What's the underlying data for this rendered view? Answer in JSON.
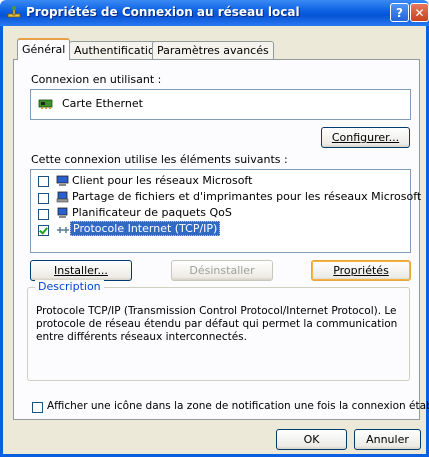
{
  "window": {
    "title": "Propriétés de Connexion au réseau local",
    "help_label": "?",
    "close_label": "✕"
  },
  "tabs": [
    {
      "label": "Général",
      "active": true
    },
    {
      "label": "Authentification",
      "active": false
    },
    {
      "label": "Paramètres avancés",
      "active": false
    }
  ],
  "connection": {
    "using_label": "Connexion en utilisant :",
    "adapter_name": "Carte Ethernet",
    "configure_button": "Configurer..."
  },
  "components": {
    "label": "Cette connexion utilise les éléments suivants :",
    "items": [
      {
        "label": "Client pour les réseaux Microsoft",
        "checked": false,
        "icon": "network-client-icon"
      },
      {
        "label": "Partage de fichiers et d'imprimantes pour les réseaux Microsoft",
        "checked": false,
        "icon": "file-printer-sharing-icon"
      },
      {
        "label": "Planificateur de paquets QoS",
        "checked": false,
        "icon": "qos-scheduler-icon"
      },
      {
        "label": "Protocole Internet (TCP/IP)",
        "checked": true,
        "selected": true,
        "icon": "network-protocol-icon"
      }
    ]
  },
  "actions": {
    "install": "Installer...",
    "uninstall": "Désinstaller",
    "properties": "Propriétés"
  },
  "description": {
    "title": "Description",
    "text": "Protocole TCP/IP (Transmission Control Protocol/Internet Protocol). Le protocole de réseau étendu par défaut qui permet la communication entre différents réseaux interconnectés."
  },
  "notify_checkbox": {
    "label": "Afficher une icône dans la zone de notification une fois la connexion établie",
    "checked": false
  },
  "footer": {
    "ok": "OK",
    "cancel": "Annuler"
  },
  "colors": {
    "titlebar": "#0a5ee0",
    "dialog_bg": "#ece9d8",
    "selection": "#316ac5",
    "group_title": "#0046d5"
  }
}
